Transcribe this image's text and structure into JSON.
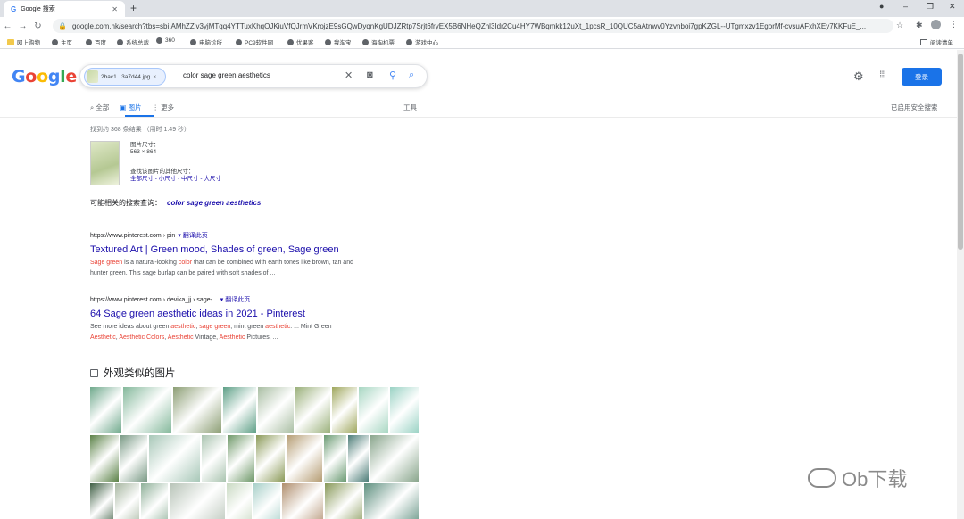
{
  "browser": {
    "tab_title": "Google 搜索",
    "url": "google.com.hk/search?tbs=sbi:AMhZZlv3yjMTqq4YTTuxKhqOJKiuVfQJrmVKrojzE9sGQwDyqnKgUDJZRtp7Srjt6fryEX5B6NHeQZhl3Idr2Cu4HY7WBqmkk12uXt_1pcsR_10QUC5aAtnwv0Yzvnboi7gpKZGL--UTgmxzv1EgorMf-cvsuAFxhXEy7KKFuE_...",
    "bookmarks": [
      "网上购物",
      "主页",
      "百度",
      "系统总裁",
      "360",
      "电脑诊所",
      "PC9软件网",
      "优果客",
      "我淘宝",
      "海淘机票",
      "游戏中心"
    ],
    "reading_list": "阅读清单"
  },
  "search": {
    "logo": "Google",
    "chip_label": "2bac1...3a7d44.jpg",
    "query": "color sage green aesthetics",
    "login": "登录"
  },
  "tabs": {
    "all": "全部",
    "images": "图片",
    "more": "更多",
    "tools": "工具",
    "safe_search": "已启用安全搜索"
  },
  "results_stats": "找到约 368 条结果 （用时 1.49 秒）",
  "image_info": {
    "size_label": "图片尺寸：",
    "size_value": "563 × 864",
    "other_sizes_label": "查找该图片的其他尺寸：",
    "other_sizes_links": "全部尺寸 - 小尺寸 - 中尺寸 - 大尺寸"
  },
  "related": {
    "label": "可能相关的搜索查询：",
    "query": "color sage green aesthetics"
  },
  "results": [
    {
      "url": "https://www.pinterest.com › pin",
      "translate": "翻译此页",
      "title": "Textured Art | Green mood, Shades of green, Sage green",
      "snippet_line1": [
        "Sage green",
        " is a natural-looking ",
        "color",
        " that can be combined with earth tones like brown, tan and"
      ],
      "snippet_line2": "hunter green. This sage burlap can be paired with soft shades of ..."
    },
    {
      "url": "https://www.pinterest.com › devika_jj › sage-...",
      "translate": "翻译此页",
      "title": "64 Sage green aesthetic ideas in 2021 - Pinterest",
      "snippet_line1": [
        "See more ideas about green ",
        "aesthetic",
        ", ",
        "sage green",
        ", mint green ",
        "aesthetic",
        ". ... Mint Green"
      ],
      "snippet_line2": [
        "Aesthetic",
        ", ",
        "Aesthetic Colors",
        ", ",
        "Aesthetic",
        " Vintage, ",
        "Aesthetic",
        " Pictures, ..."
      ]
    }
  ],
  "similar": {
    "heading": "外观类似的图片",
    "colors": [
      [
        "#6fa98c",
        "#84b89b",
        "#8c9e74",
        "#5d9f86",
        "#a9bea3",
        "#9ab07a",
        "#9fa75d",
        "#a7d6c2",
        "#9ad2c4"
      ],
      [
        "#5c8248",
        "#7a9a85",
        "#a8c8b8",
        "#aac4b0",
        "#6e9868",
        "#8b9a58",
        "#b59c72",
        "#6a9a72",
        "#4d7d78",
        "#8aa68d",
        "#7fc2b2"
      ],
      [
        "#3f5f44",
        "#a6b6a0",
        "#8eb098",
        "#b7c3b7",
        "#c9d9c2",
        "#a7cfc8",
        "#b08e6d",
        "#879858",
        "#5d8f7e"
      ]
    ]
  },
  "watermark": "Ob下载"
}
